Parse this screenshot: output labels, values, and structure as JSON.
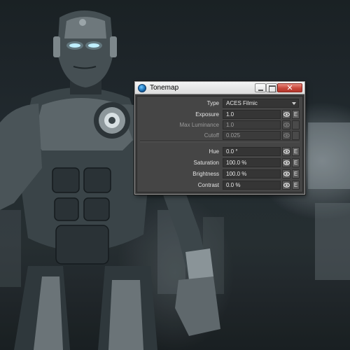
{
  "window": {
    "title": "Tonemap",
    "close_glyph": "✕"
  },
  "tonemap": {
    "type": {
      "label": "Type",
      "value": "ACES Filmic"
    },
    "exposure": {
      "label": "Exposure",
      "value": "1.0",
      "enabled": true
    },
    "max_luminance": {
      "label": "Max Luminance",
      "value": "1.0",
      "enabled": false
    },
    "cutoff": {
      "label": "Cutoff",
      "value": "0.025",
      "enabled": false
    },
    "hue": {
      "label": "Hue",
      "value": "0.0 °",
      "enabled": true
    },
    "saturation": {
      "label": "Saturation",
      "value": "100.0 %",
      "enabled": true
    },
    "brightness": {
      "label": "Brightness",
      "value": "100.0 %",
      "enabled": true
    },
    "contrast": {
      "label": "Contrast",
      "value": "0.0 %",
      "enabled": true
    },
    "e_label": "E"
  },
  "icons": {
    "app": "lightwave-app-icon",
    "envelope": "eye-icon",
    "dropdown": "chevron-down-icon"
  },
  "colors": {
    "panel_bg": "#454545",
    "field_bg": "#353535",
    "close_button": "#c8463a",
    "eye_glow": "#bfefff"
  }
}
